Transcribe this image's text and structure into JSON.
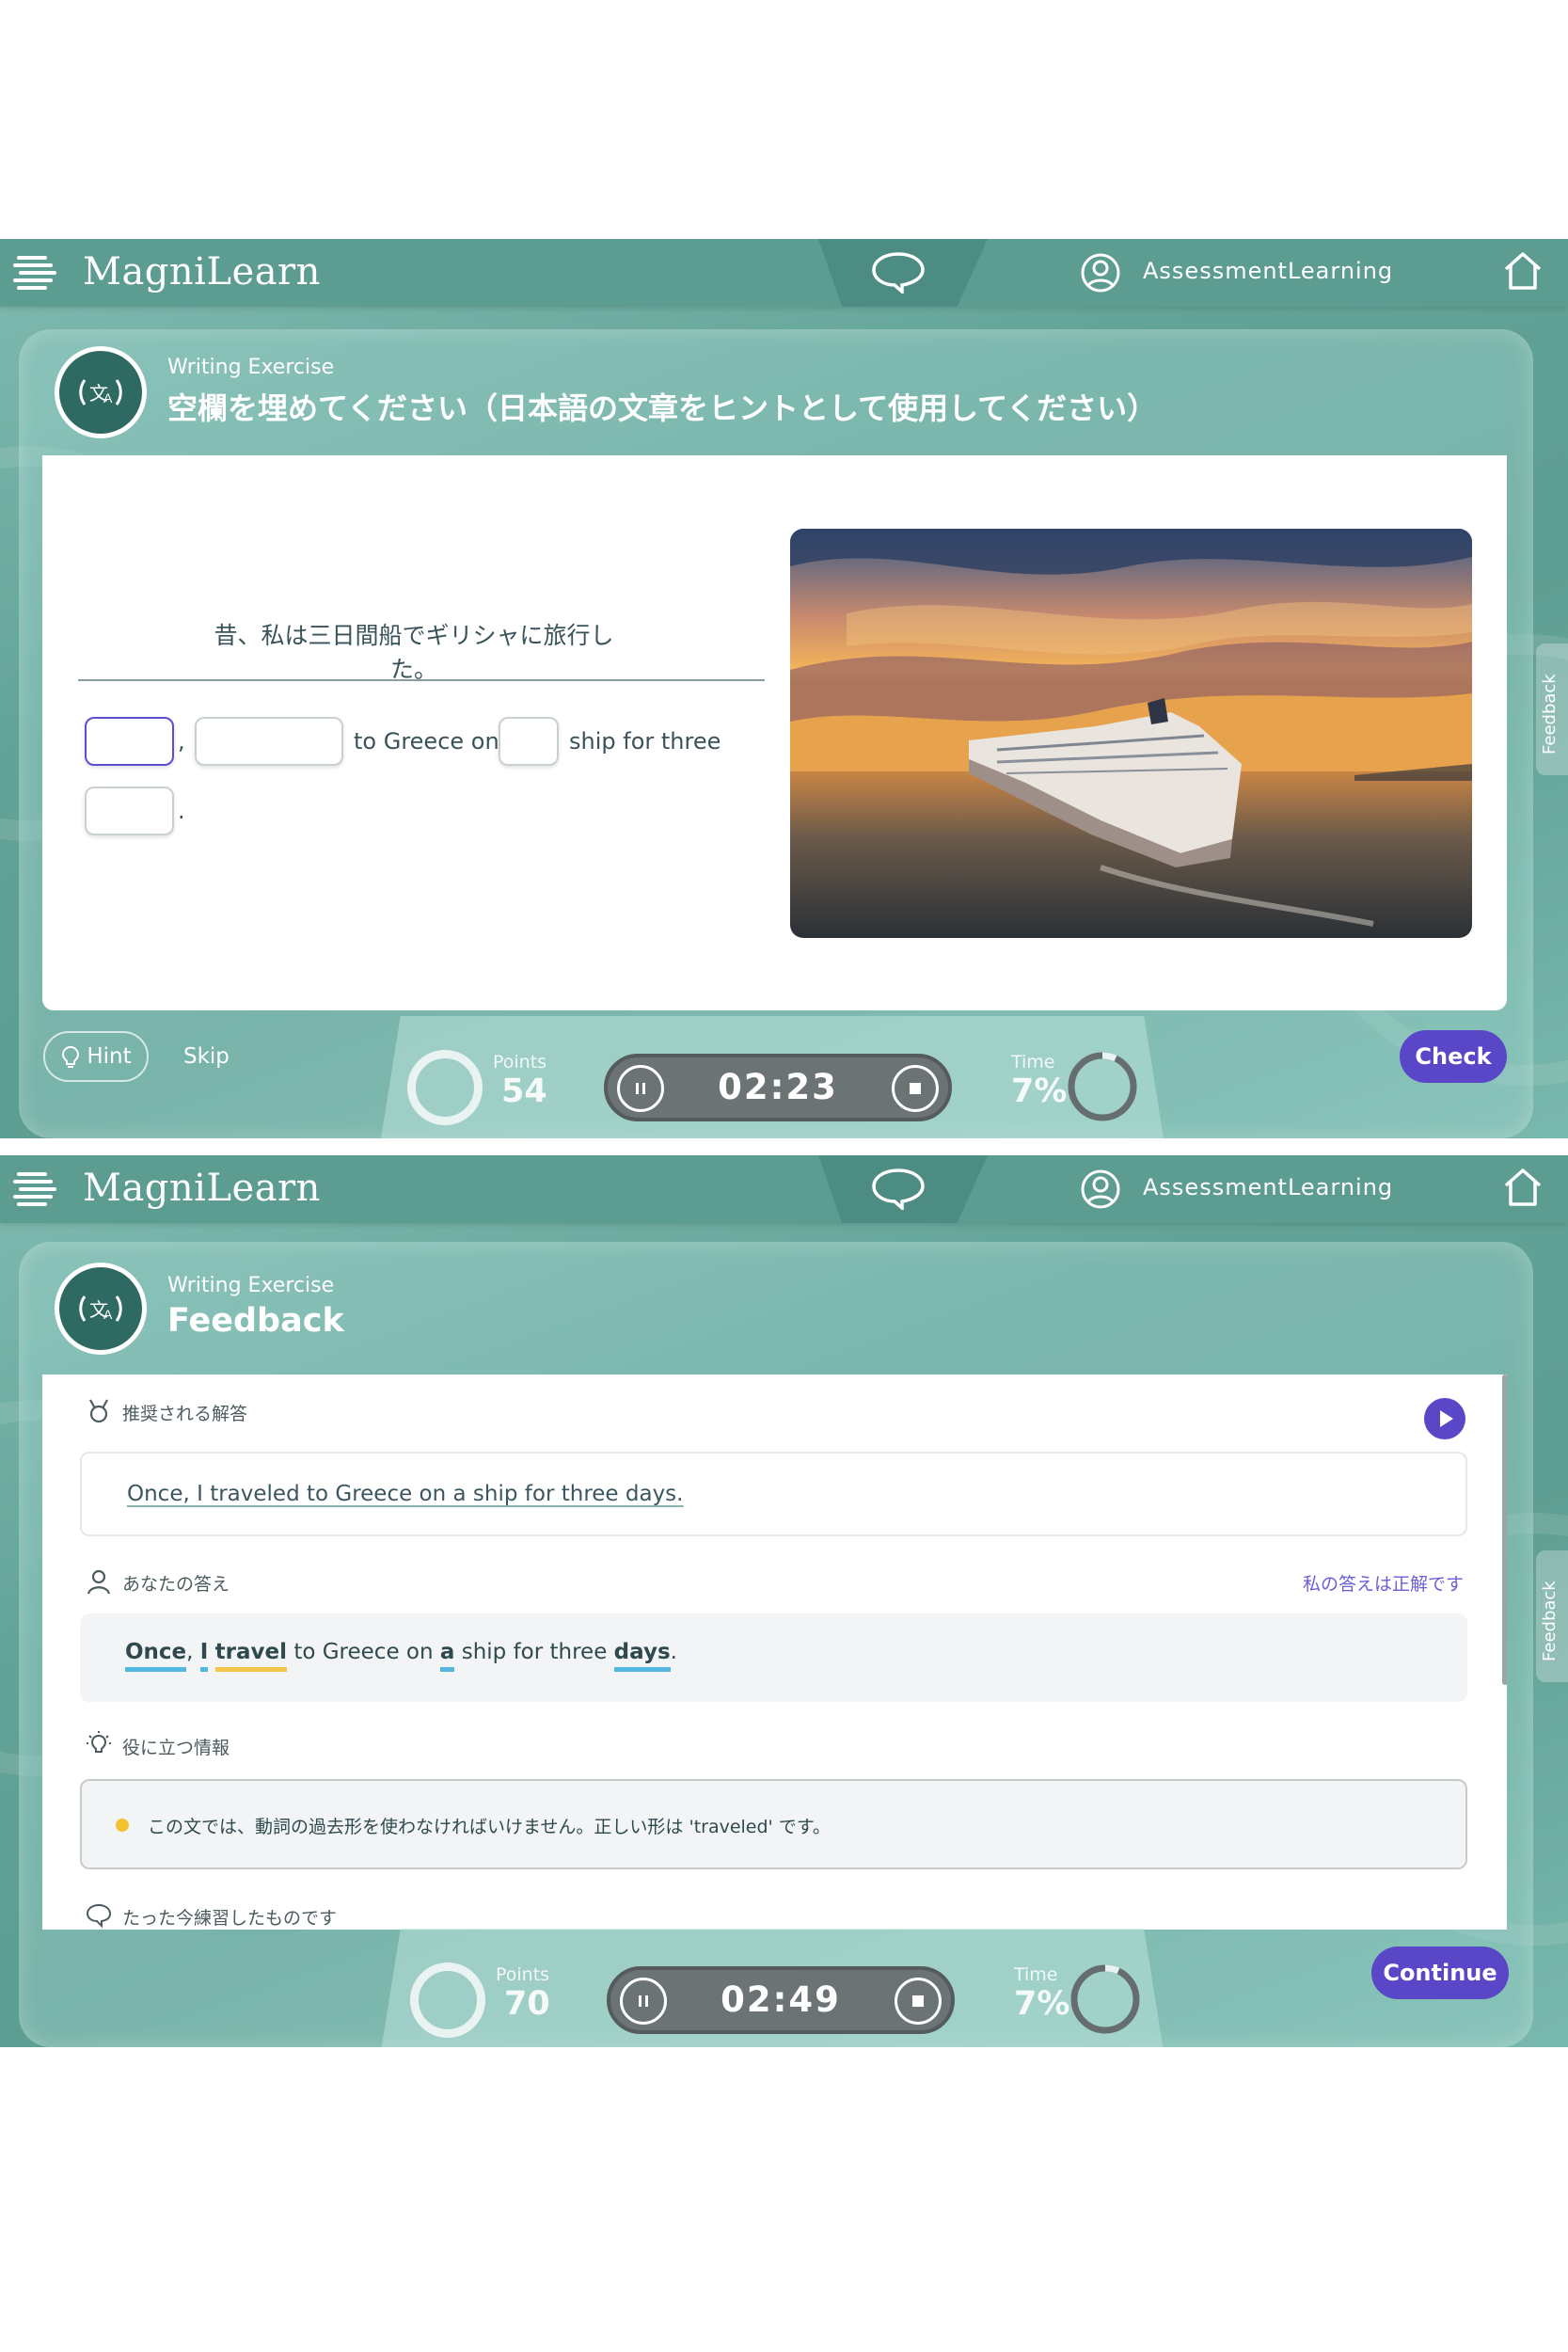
{
  "screen1": {
    "brand": "MagniLearn",
    "user_name": "AssessmentLearning",
    "header_sub": "Writing Exercise",
    "header_title": "空欄を埋めてください（日本語の文章をヒントとして使用してください）",
    "japanese_sentence": "昔、私は三日間船でギリシャに旅行した。",
    "sentence_parts": {
      "comma": ",",
      "to_greece_on": "to Greece on",
      "ship_for_three": "ship for three",
      "period": "."
    },
    "hint_label": "Hint",
    "skip_label": "Skip",
    "check_label": "Check",
    "points_label": "Points",
    "points_value": "54",
    "timer_value": "02:23",
    "time_label": "Time",
    "time_value": "7%",
    "feedback_tab": "Feedback"
  },
  "screen2": {
    "brand": "MagniLearn",
    "user_name": "AssessmentLearning",
    "header_sub": "Writing Exercise",
    "header_title": "Feedback",
    "recommended_label": "推奨される解答",
    "recommended_answer": "Once, I traveled to Greece on a ship for three days.",
    "your_answer_label": "あなたの答え",
    "my_answer_correct_link": "私の答えは正解です",
    "your_answer_tokens": {
      "once": "Once",
      "comma": ",",
      "i": "I",
      "travel": "travel",
      "to_greece_on": " to Greece on ",
      "a": "a",
      "ship_for_three": " ship for three ",
      "days": "days",
      "period": "."
    },
    "useful_info_label": "役に立つ情報",
    "useful_info_text": "この文では、動詞の過去形を使わなければいけません。正しい形は 'traveled' です。",
    "just_practiced_label": "たった今練習したものです",
    "continue_label": "Continue",
    "points_label": "Points",
    "points_value": "70",
    "timer_value": "02:49",
    "time_label": "Time",
    "time_value": "7%",
    "feedback_tab": "Feedback"
  },
  "colors": {
    "accent_purple": "#5a47c8",
    "teal_dark": "#2e6a62",
    "token_blue": "#52b8e0",
    "token_yellow": "#f4c54a",
    "info_dot": "#f2c230"
  },
  "icons": [
    "logo-icon",
    "chat-bubble-icon",
    "user-icon",
    "home-icon",
    "translate-icon",
    "lightbulb-icon",
    "pause-icon",
    "stop-icon",
    "medal-icon",
    "person-icon",
    "play-icon",
    "speech-bubble-icon",
    "feedback-icon"
  ]
}
